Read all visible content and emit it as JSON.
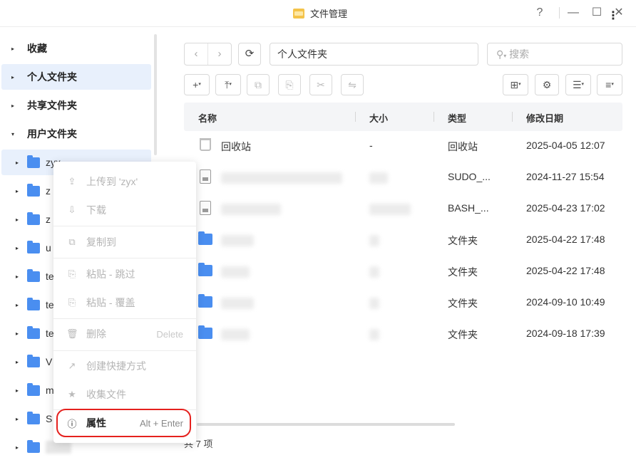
{
  "window": {
    "title": "文件管理",
    "controls": {
      "help": "?",
      "minimize": "—",
      "maximize": "☐",
      "close": "✕"
    }
  },
  "sidebar": {
    "sections": [
      {
        "label": "收藏",
        "caret": "▸"
      },
      {
        "label": "个人文件夹",
        "caret": "▸"
      },
      {
        "label": "共享文件夹",
        "caret": "▸"
      },
      {
        "label": "用户文件夹",
        "caret": "▾"
      }
    ],
    "user_folders": [
      {
        "label": "zyx"
      },
      {
        "label": "z"
      },
      {
        "label": "z"
      },
      {
        "label": "u"
      },
      {
        "label": "te"
      },
      {
        "label": "te"
      },
      {
        "label": "te"
      },
      {
        "label": "V"
      },
      {
        "label": "m"
      },
      {
        "label": "S"
      },
      {
        "label": ""
      }
    ]
  },
  "toolbar": {
    "back": "‹",
    "forward": "›",
    "refresh": "⟳",
    "path": "个人文件夹",
    "search_placeholder": "搜索",
    "search_icon": "⚲",
    "buttons": [
      {
        "icon": "+",
        "name": "new-icon"
      },
      {
        "icon": "⤒",
        "name": "upload-icon"
      },
      {
        "icon": "⧉",
        "name": "copy-icon"
      },
      {
        "icon": "⎘",
        "name": "paste-icon"
      },
      {
        "icon": "✂",
        "name": "cut-icon"
      },
      {
        "icon": "⇋",
        "name": "rename-icon"
      }
    ],
    "right_buttons": [
      {
        "icon": "⊞",
        "name": "toolbox-icon"
      },
      {
        "icon": "⚙",
        "name": "settings-icon"
      },
      {
        "icon": "☰",
        "name": "view-icon"
      },
      {
        "icon": "≡",
        "name": "sort-icon"
      }
    ]
  },
  "table": {
    "headers": {
      "name": "名称",
      "size": "大小",
      "type": "类型",
      "modified": "修改日期",
      "more": "⋮"
    },
    "rows": [
      {
        "icon": "trash",
        "name": "回收站",
        "size": "-",
        "type": "回收站",
        "modified": "2025-04-05 12:07"
      },
      {
        "icon": "file",
        "name": "",
        "size": "",
        "type": "SUDO_...",
        "modified": "2024-11-27 15:54"
      },
      {
        "icon": "file",
        "name": "",
        "size": "",
        "type": "BASH_...",
        "modified": "2025-04-23 17:02"
      },
      {
        "icon": "folder",
        "name": "",
        "size": "",
        "type": "文件夹",
        "modified": "2025-04-22 17:48"
      },
      {
        "icon": "folder",
        "name": "",
        "size": "",
        "type": "文件夹",
        "modified": "2025-04-22 17:48"
      },
      {
        "icon": "folder",
        "name": "",
        "size": "",
        "type": "文件夹",
        "modified": "2024-09-10 10:49"
      },
      {
        "icon": "folder",
        "name": "",
        "size": "",
        "type": "文件夹",
        "modified": "2024-09-18 17:39"
      }
    ],
    "status": "共 7 项"
  },
  "context_menu": {
    "items": [
      {
        "icon": "⇪",
        "label": "上传到 'zyx'",
        "shortcut": ""
      },
      {
        "icon": "⇩",
        "label": "下载",
        "shortcut": ""
      },
      {
        "icon": "⧉",
        "label": "复制到",
        "shortcut": ""
      },
      {
        "icon": "⎘",
        "label": "粘贴 - 跳过",
        "shortcut": ""
      },
      {
        "icon": "⎘",
        "label": "粘贴 - 覆盖",
        "shortcut": ""
      },
      {
        "icon": "🗑",
        "label": "删除",
        "shortcut": "Delete"
      },
      {
        "icon": "↗",
        "label": "创建快捷方式",
        "shortcut": ""
      },
      {
        "icon": "★",
        "label": "收集文件",
        "shortcut": ""
      },
      {
        "icon": "ⓘ",
        "label": "属性",
        "shortcut": "Alt + Enter"
      }
    ]
  },
  "colors": {
    "accent": "#4a8ef0",
    "selected_bg": "#e8f0fc",
    "highlight_ring": "#e5211e"
  }
}
